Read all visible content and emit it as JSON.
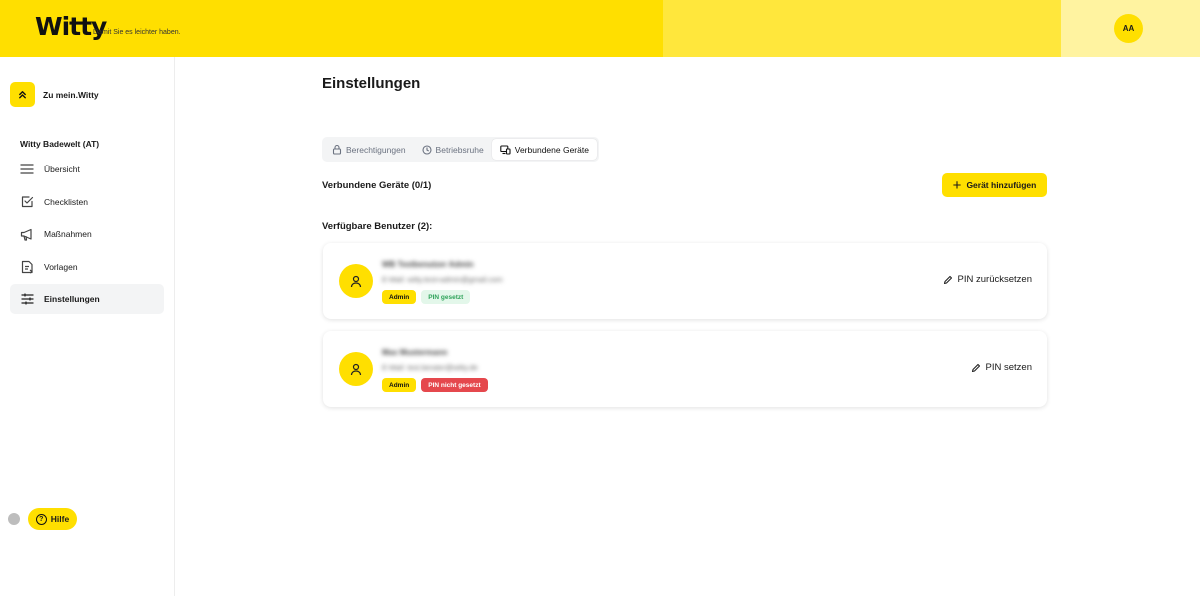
{
  "header": {
    "logo": "Witty",
    "tagline": "Damit Sie es leichter haben.",
    "avatar_initials": "AA",
    "colors": {
      "primary": "#ffdf00",
      "mid": "#ffe73c",
      "light": "#fff3a0"
    }
  },
  "sidebar": {
    "back_label": "Zu mein.Witty",
    "org_name": "Witty Badewelt (AT)",
    "items": [
      {
        "label": "Übersicht",
        "icon": "menu-icon"
      },
      {
        "label": "Checklisten",
        "icon": "checkbox-icon"
      },
      {
        "label": "Maßnahmen",
        "icon": "megaphone-icon"
      },
      {
        "label": "Vorlagen",
        "icon": "template-icon"
      },
      {
        "label": "Einstellungen",
        "icon": "sliders-icon",
        "active": true
      }
    ],
    "help_label": "Hilfe"
  },
  "main": {
    "title": "Einstellungen",
    "tabs": [
      {
        "label": "Berechtigungen",
        "icon": "lock-icon"
      },
      {
        "label": "Betriebsruhe",
        "icon": "clock-icon"
      },
      {
        "label": "Verbundene Geräte",
        "icon": "devices-icon",
        "active": true
      }
    ],
    "devices_title": "Verbundene Geräte (0/1)",
    "add_device_label": "Gerät hinzufügen",
    "users_title": "Verfügbare Benutzer (2):",
    "users": [
      {
        "name": "WB Testbenutzer Admin",
        "email": "E-Mail: witty.test+admin@gmail.com",
        "role": "Admin",
        "pin_status": "PIN gesetzt",
        "pin_set": true,
        "action_label": "PIN zurücksetzen"
      },
      {
        "name": "Max Mustermann",
        "email": "E-Mail: test.berater@witty.de",
        "role": "Admin",
        "pin_status": "PIN nicht gesetzt",
        "pin_set": false,
        "action_label": "PIN setzen"
      }
    ]
  }
}
